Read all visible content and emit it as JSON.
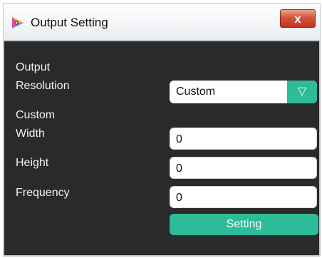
{
  "window": {
    "title": "Output Setting",
    "close_label": "x"
  },
  "form": {
    "output_label_line1": "Output",
    "output_label_line2": "Resolution",
    "resolution_value": "Custom",
    "dropdown_glyph": "▽",
    "custom_label": "Custom",
    "width_label": "Width",
    "width_value": "0",
    "height_label": "Height",
    "height_value": "0",
    "frequency_label": "Frequency",
    "frequency_value": "0",
    "setting_button": "Setting"
  },
  "colors": {
    "accent": "#2dbb98",
    "panel_bg": "#2a2a2a",
    "close_red": "#c2331d"
  }
}
